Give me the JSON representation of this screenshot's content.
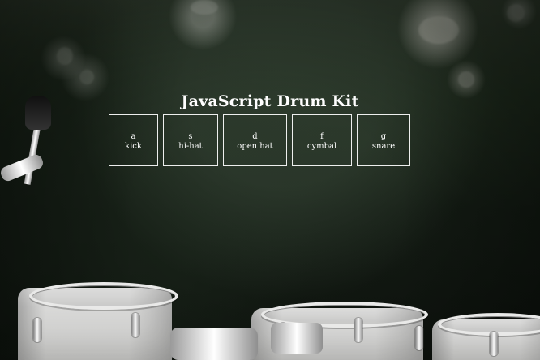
{
  "page": {
    "title": "JavaScript Drum Kit"
  },
  "keys": [
    {
      "key": "a",
      "sound": "kick"
    },
    {
      "key": "s",
      "sound": "hi-hat"
    },
    {
      "key": "d",
      "sound": "open hat"
    },
    {
      "key": "f",
      "sound": "cymbal"
    },
    {
      "key": "g",
      "sound": "snare"
    }
  ],
  "theme": {
    "text_color": "#ffffff",
    "border_color": "#ffffff"
  }
}
